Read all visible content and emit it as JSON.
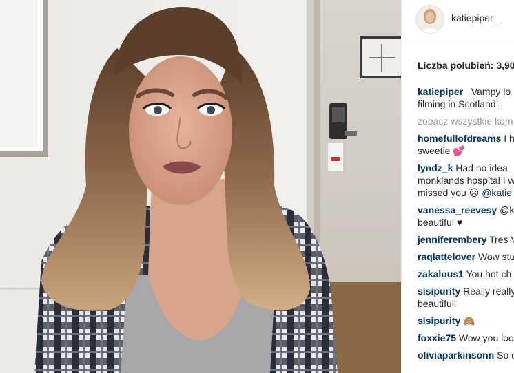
{
  "post": {
    "username": "katiepiper_",
    "likes_text": "Liczba polubień: 3,90",
    "caption": {
      "author": "katiepiper_",
      "line1": "Vampy lo",
      "line2": "filming in Scotland!"
    },
    "see_all": "zobacz wszystkie kom",
    "comments": [
      {
        "author": "homefullofdreams",
        "text": "I h",
        "line2": "sweetie",
        "line2_emoji": "two-hearts"
      },
      {
        "author": "lyndz_k",
        "text": "Had no idea",
        "line2": "monklands hospital I w",
        "line3": "missed you",
        "line3_emoji": "sad-face",
        "line3_mention": "@katie"
      },
      {
        "author": "vanessa_reevesy",
        "text": "@k",
        "line2": "beautiful",
        "line2_emoji": "black-heart"
      },
      {
        "author": "jenniferembery",
        "text": "Tres V"
      },
      {
        "author": "raqlattelover",
        "text": "Wow stu"
      },
      {
        "author": "zakalous1",
        "text": "You hot ch"
      },
      {
        "author": "sisipurity",
        "text": "Really really",
        "line2": "beautifull"
      },
      {
        "author": "sisipurity",
        "text": "",
        "emoji": "monkey"
      },
      {
        "author": "foxxie75",
        "text": "Wow you loo"
      },
      {
        "author": "oliviaparkinsonn",
        "text": "So c"
      }
    ]
  },
  "colors": {
    "text": "#262626",
    "link": "#003569",
    "muted": "#999999",
    "border": "#efefef"
  }
}
